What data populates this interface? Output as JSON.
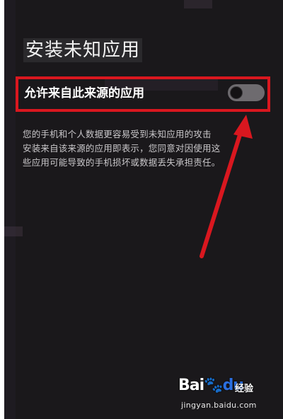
{
  "screen": {
    "title": "安装未知应用"
  },
  "setting": {
    "label": "允许来自此来源的应用",
    "enabled": false
  },
  "description": {
    "text": "您的手机和个人数据更容易受到未知应用的攻击\n安装来自该来源的应用即表示，您同意对因使用这\n些应用可能导致的手机损坏或数据丢失承担责任。"
  },
  "annotation": {
    "highlight_color": "#d9171f",
    "arrow_color": "#d9171f"
  },
  "watermark": {
    "brand_bai": "Bai",
    "brand_du": "du",
    "sub": "经验",
    "url": "jingyan.baidu.com"
  }
}
